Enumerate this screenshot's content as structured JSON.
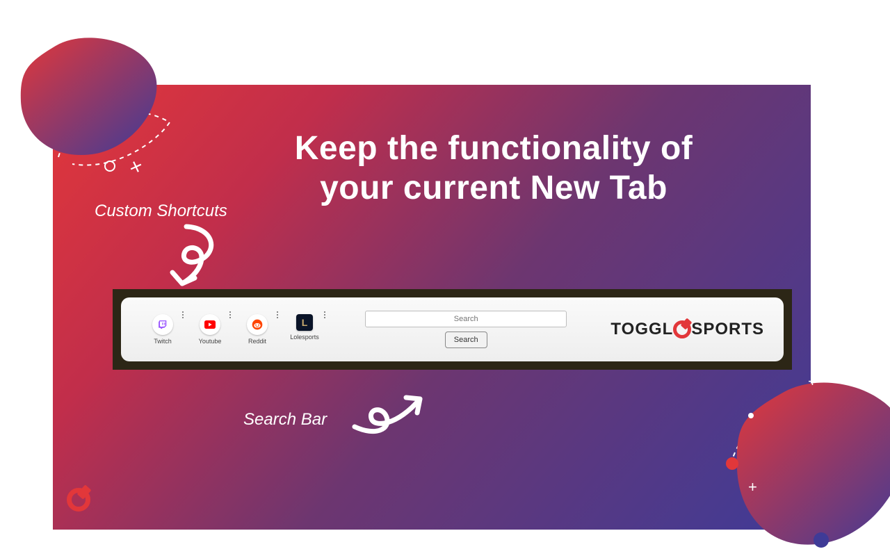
{
  "headline_line1": "Keep the functionality of",
  "headline_line2": "your current New Tab",
  "annotations": {
    "shortcuts": "Custom Shortcuts",
    "search": "Search Bar"
  },
  "preview": {
    "shortcuts": [
      {
        "label": "Twitch"
      },
      {
        "label": "Youtube"
      },
      {
        "label": "Reddit"
      },
      {
        "label": "Lolesports"
      }
    ],
    "search": {
      "placeholder": "Search",
      "button": "Search"
    },
    "brand_left": "TOGGL",
    "brand_right": "SPORTS"
  }
}
